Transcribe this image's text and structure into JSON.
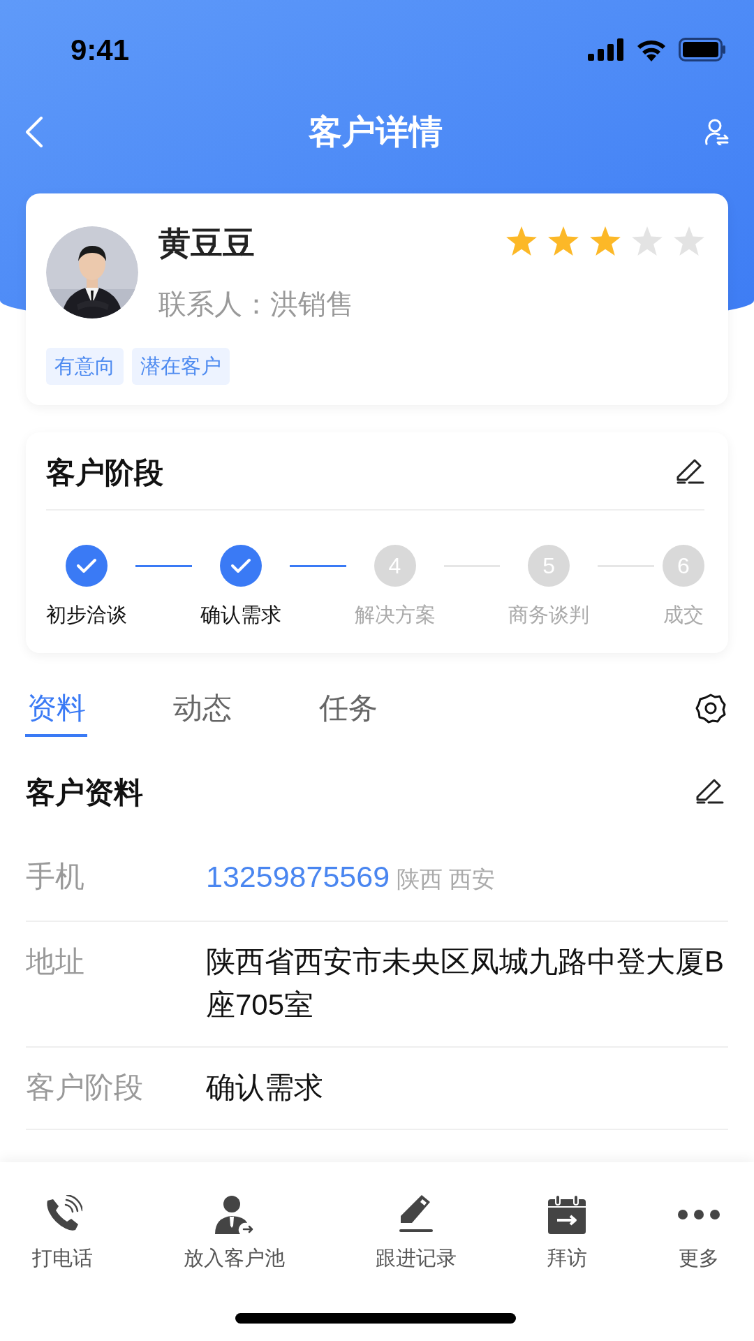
{
  "status_bar": {
    "time": "9:41"
  },
  "nav": {
    "title": "客户详情"
  },
  "customer": {
    "name": "黄豆豆",
    "contact": "联系人：洪销售",
    "stars": 3,
    "tags": [
      "有意向",
      "潜在客户"
    ]
  },
  "stage_card": {
    "title": "客户阶段",
    "steps": [
      {
        "label": "初步洽谈",
        "done": true
      },
      {
        "label": "确认需求",
        "done": true
      },
      {
        "label": "解决方案",
        "done": false,
        "number": "4"
      },
      {
        "label": "商务谈判",
        "done": false,
        "number": "5"
      },
      {
        "label": "成交",
        "done": false,
        "number": "6"
      }
    ]
  },
  "tabs": [
    {
      "label": "资料",
      "selected": true
    },
    {
      "label": "动态",
      "selected": false
    },
    {
      "label": "任务",
      "selected": false
    }
  ],
  "profile": {
    "title": "客户资料",
    "rows": [
      {
        "label": "手机",
        "kind": "phone",
        "value": "13259875569",
        "note": "陕西 西安"
      },
      {
        "label": "地址",
        "kind": "text",
        "value": "陕西省西安市未央区凤城九路中登大厦B座705室"
      },
      {
        "label": "客户阶段",
        "kind": "text",
        "value": "确认需求"
      }
    ]
  },
  "actions": [
    {
      "label": "打电话",
      "kind": "call"
    },
    {
      "label": "放入客户池",
      "kind": "pool"
    },
    {
      "label": "跟进记录",
      "kind": "note"
    },
    {
      "label": "拜访",
      "kind": "visit"
    },
    {
      "label": "更多",
      "kind": "more"
    }
  ]
}
